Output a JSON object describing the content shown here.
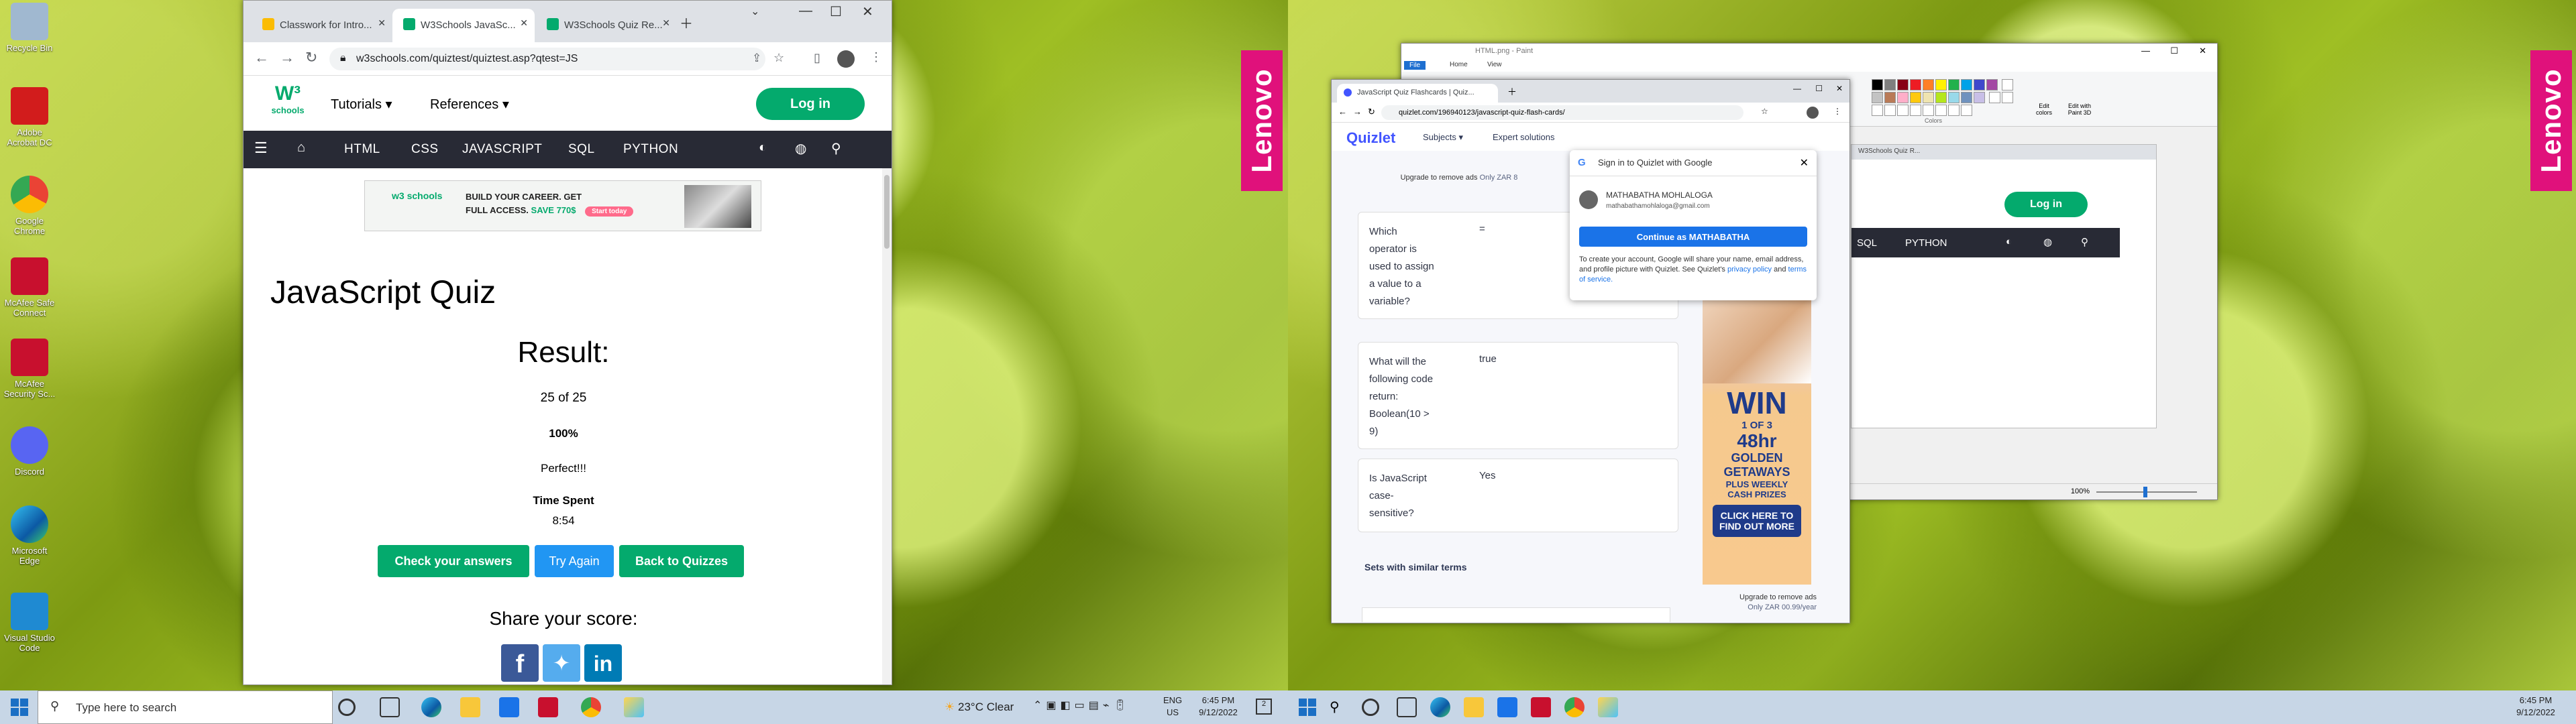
{
  "desktop": {
    "icons": [
      {
        "label": "Recycle Bin",
        "color": "#a0b8d0"
      },
      {
        "label": "Adobe Acrobat DC",
        "color": "#d21c1c"
      },
      {
        "label": "Google Chrome",
        "color": "#4285f4"
      },
      {
        "label": "McAfee Safe Connect",
        "color": "#c8102e"
      },
      {
        "label": "McAfee Security Sc...",
        "color": "#c8102e"
      },
      {
        "label": "Discord",
        "color": "#5865f2"
      },
      {
        "label": "Microsoft Edge",
        "color": "#0c8fd6"
      },
      {
        "label": "Visual Studio Code",
        "color": "#1f8ad2"
      }
    ],
    "brand": "Lenovo"
  },
  "left_browser": {
    "tabs": [
      {
        "label": "Classwork for Intro...",
        "color": "#fbbc04"
      },
      {
        "label": "W3Schools JavaSc...",
        "color": "#04aa6d"
      },
      {
        "label": "W3Schools Quiz Re...",
        "color": "#04aa6d"
      }
    ],
    "url": "w3schools.com/quiztest/quiztest.asp?qtest=JS",
    "logo": "w3 schools",
    "menu": {
      "tutorials": "Tutorials",
      "references": "References",
      "login": "Log in"
    },
    "nav_items": [
      "HTML",
      "CSS",
      "JAVASCRIPT",
      "SQL",
      "PYTHON"
    ],
    "ad": {
      "line1": "BUILD YOUR CAREER. GET",
      "line2": "FULL ACCESS.",
      "save": "SAVE 770$",
      "btn": "Start today",
      "logo": "w3 schools"
    },
    "quiz": {
      "title": "JavaScript Quiz",
      "result_heading": "Result:",
      "score": "25 of 25",
      "percent": "100%",
      "message": "Perfect!!!",
      "time_label": "Time Spent",
      "time_value": "8:54",
      "buttons": {
        "check": "Check your answers",
        "again": "Try Again",
        "back": "Back to Quizzes"
      },
      "share": "Share your score:"
    }
  },
  "taskbar_left": {
    "search_placeholder": "Type here to search",
    "weather": "23°C Clear",
    "lang1": "ENG",
    "lang2": "US",
    "time": "6:45 PM",
    "date": "9/12/2022",
    "notif": "2"
  },
  "taskbar_right": {
    "time": "6:45 PM",
    "date": "9/12/2022"
  },
  "paint": {
    "title": "HTML.png - Paint",
    "menu": [
      "File",
      "Home",
      "View"
    ],
    "colors_label": "Colors",
    "edit_colors": "Edit colors",
    "edit_paint3d": "Edit with Paint 3D",
    "zoom": "100%",
    "inner_login": "Log in",
    "inner_nav": [
      "SQL",
      "PYTHON"
    ],
    "inner_tab": "W3Schools Quiz R..."
  },
  "quizlet_browser": {
    "tab": "JavaScript Quiz Flashcards | Quiz...",
    "url": "quizlet.com/196940123/javascript-quiz-flash-cards/",
    "logo": "Quizlet",
    "nav": [
      "Subjects",
      "Expert solutions"
    ],
    "upgrade": "Upgrade to remove ads",
    "upgrade_price": "Only ZAR 8",
    "rows": [
      {
        "q": "Which operator is used to assign a value to a variable?",
        "a": "="
      },
      {
        "q": "What will the following code return: Boolean(10 > 9)",
        "a": "true"
      },
      {
        "q": "Is JavaScript case-sensitive?",
        "a": "Yes"
      }
    ],
    "similar": "Sets with similar terms",
    "ad": {
      "win": "WIN",
      "odds": "1 OF 3",
      "hours": "48hr",
      "l1": "GOLDEN",
      "l2": "GETAWAYS",
      "l3": "PLUS WEEKLY",
      "l4": "CASH PRIZES",
      "cta": "CLICK HERE TO FIND OUT MORE"
    },
    "ad_foot1": "Upgrade to remove ads",
    "ad_foot2": "Only ZAR 00.99/year",
    "google_popup": {
      "title": "Sign in to Quizlet with Google",
      "name": "MATHABATHA MOHLALOGA",
      "email": "mathabathamohlaloga@gmail.com",
      "continue": "Continue as MATHABATHA",
      "text1": "To create your account, Google will share your name, email address, and profile picture with Quizlet. See Quizlet's",
      "privacy": "privacy policy",
      "and": "and",
      "terms": "terms of service."
    }
  }
}
